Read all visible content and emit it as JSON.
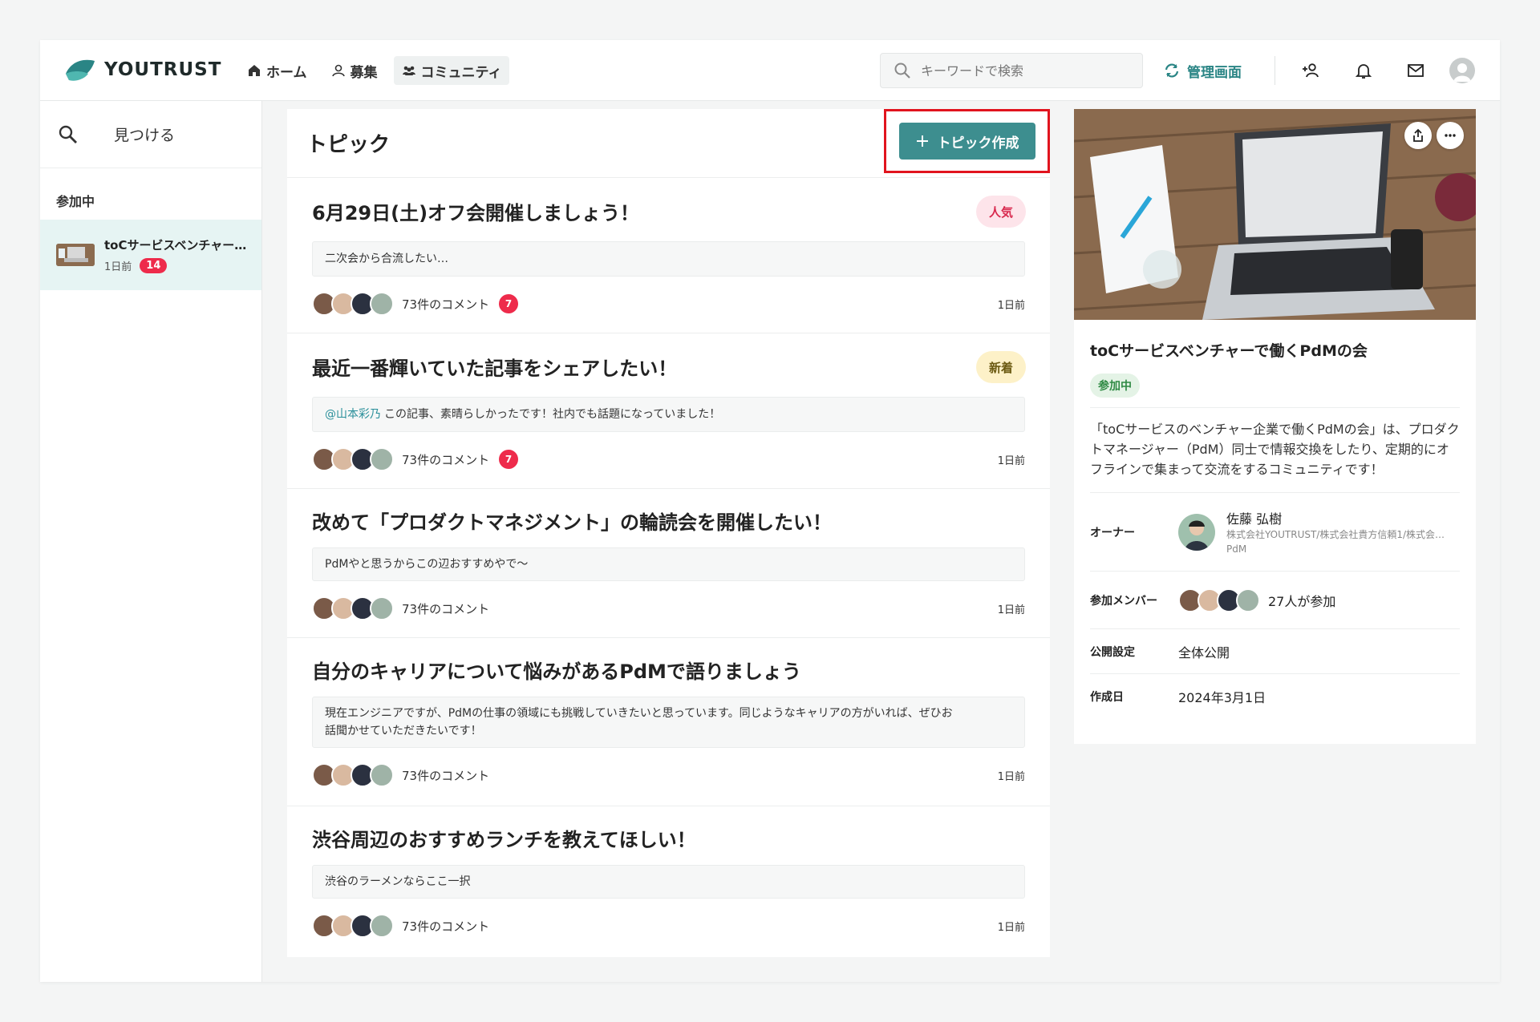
{
  "header": {
    "brand": "YOUTRUST",
    "nav": [
      {
        "label": "ホーム",
        "icon": "home-icon"
      },
      {
        "label": "募集",
        "icon": "recruit-icon"
      },
      {
        "label": "コミュニティ",
        "icon": "community-icon"
      }
    ],
    "search_placeholder": "キーワードで検索",
    "admin_label": "管理画面"
  },
  "sidebar": {
    "find_label": "見つける",
    "joined_label": "参加中",
    "community": {
      "title": "toCサービスベンチャー…",
      "time": "1日前",
      "count": "14"
    }
  },
  "main": {
    "title": "トピック",
    "create_label": "トピック作成",
    "topics": [
      {
        "title": "6月29日(土)オフ会開催しましょう！",
        "tag": "人気",
        "snippet": "二次会から合流したい…",
        "comments": "73件のコメント",
        "badge": "7",
        "time": "1日前"
      },
      {
        "title": "最近一番輝いていた記事をシェアしたい！",
        "tag": "新着",
        "mention": "@山本彩乃",
        "snippet": "この記事、素晴らしかったです！社内でも話題になっていました！",
        "comments": "73件のコメント",
        "badge": "7",
        "time": "1日前"
      },
      {
        "title": "改めて「プロダクトマネジメント」の輪読会を開催したい！",
        "snippet": "PdMやと思うからこの辺おすすめやで〜",
        "comments": "73件のコメント",
        "time": "1日前"
      },
      {
        "title": "自分のキャリアについて悩みがあるPdMで語りましょう",
        "snippet_line1": "現在エンジニアですが、PdMの仕事の領域にも挑戦していきたいと思っています。同じようなキャリアの方がいれば、ぜひお",
        "snippet_line2": "話聞かせていただきたいです！",
        "comments": "73件のコメント",
        "time": "1日前"
      },
      {
        "title": "渋谷周辺のおすすめランチを教えてほしい！",
        "snippet": "渋谷のラーメンならここ一択",
        "comments": "73件のコメント",
        "time": "1日前"
      }
    ]
  },
  "panel": {
    "title": "toCサービスベンチャーで働くPdMの会",
    "joined": "参加中",
    "desc": "「toCサービスのベンチャー企業で働くPdMの会」は、プロダクトマネージャー（PdM）同士で情報交換をしたり、定期的にオフラインで集まって交流をするコミュニティです！",
    "owner_label": "オーナー",
    "owner_name": "佐藤 弘樹",
    "owner_company": "株式会社YOUTRUST/株式会社貴方信頼1/株式会…",
    "owner_role": "PdM",
    "members_label": "参加メンバー",
    "members_text": "27人が参加",
    "visibility_label": "公開設定",
    "visibility": "全体公開",
    "created_label": "作成日",
    "created": "2024年3月1日"
  },
  "colors": {
    "accent": "#3d8e8f",
    "highlight_border": "#e1141e",
    "badge": "#ee2b4b"
  }
}
